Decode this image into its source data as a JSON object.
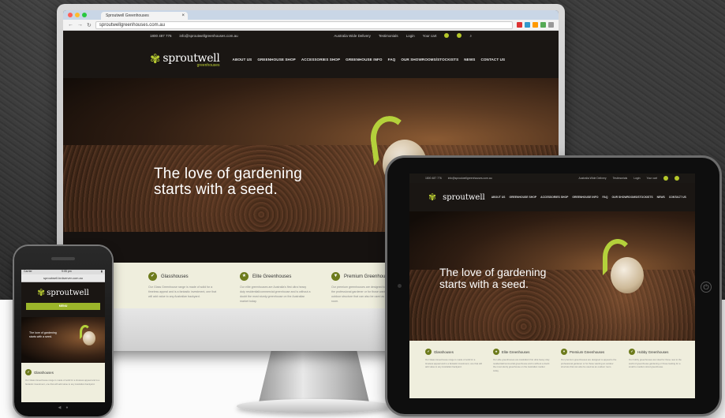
{
  "browser": {
    "tab_title": "Sproutwell Greenhouses",
    "url": "sproutwellgreenhouses.com.au"
  },
  "site": {
    "topbar": {
      "phone": "1800 487 776",
      "email": "info@sproutwellgreenhouses.com.au",
      "delivery": "Australia Wide Delivery",
      "testimonials": "Testimonials",
      "login": "Login",
      "cart": "Your cart"
    },
    "logo": {
      "name": "sproutwell",
      "sub": "greenhouses"
    },
    "nav": [
      "ABOUT US",
      "GREENHOUSE SHOP",
      "ACCESSORIES SHOP",
      "GREENHOUSE INFO",
      "FAQ",
      "OUR SHOWROOMS/STOCKISTS",
      "NEWS",
      "CONTACT US"
    ],
    "hero_headline_line1": "The love of gardening",
    "hero_headline_line2": "starts with a seed.",
    "features": [
      {
        "title": "Glasshouses",
        "icon": "check-icon",
        "body": "Our Glass Greenhouse range is made of solid for a timeless appeal and is a fantastic investment, one that will add value to any Australian backyard."
      },
      {
        "title": "Elite Greenhouses",
        "icon": "star-icon",
        "body": "Our elite greenhouses are Australia's first ultra heavy duty residential/commercial greenhouse and is without a doubt the most sturdy greenhouse on the Australian market today."
      },
      {
        "title": "Premium Greenhouses",
        "icon": "trophy-icon",
        "body": "Our premium greenhouses are designed to appeal to the professional gardener or for those wanting an outdoor structure that can also be used as an outdoor room."
      },
      {
        "title": "Hobby Greenhouses",
        "icon": "check-icon",
        "body": "Our hobby greenhouses are ideal for those new to the world of greenhouse gardening or those looking for a small to medium sized greenhouse."
      }
    ]
  },
  "phone_site": {
    "carrier": "Carrier",
    "time": "9:05 pm",
    "url": "sproutwell.brdserver.com.au",
    "menu_label": "MENU"
  },
  "colors": {
    "brand_green": "#b9cc32",
    "badge_green": "#6d7b1c",
    "feature_panel": "#efeedd"
  }
}
